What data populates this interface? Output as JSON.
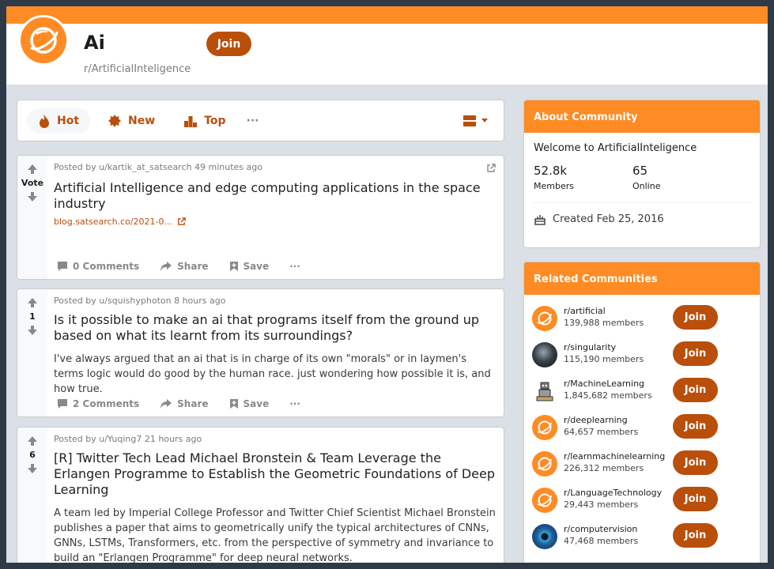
{
  "subreddit": {
    "title": "Ai",
    "name": "r/ArtificialInteligence",
    "join_label": "Join"
  },
  "sort": {
    "hot": "Hot",
    "new": "New",
    "top": "Top",
    "more": "···"
  },
  "posts": [
    {
      "meta": "Posted by u/kartik_at_satsearch 49 minutes ago",
      "vote": "Vote",
      "title": "Artificial Intelligence and edge computing applications in the space industry",
      "link": "blog.satsearch.co/2021-0...",
      "comments": "0 Comments",
      "share": "Share",
      "save": "Save"
    },
    {
      "meta": "Posted by u/squishyphoton 8 hours ago",
      "vote": "1",
      "title": "Is it possible to make an ai that programs itself from the ground up based on what its learnt from its surroundings?",
      "text": "I've always argued that an ai that is in charge of its own \"morals\" or in laymen's terms logic would do good by the human race. just wondering how possible it is, and how true.",
      "comments": "2 Comments",
      "share": "Share",
      "save": "Save"
    },
    {
      "meta": "Posted by u/Yuqing7 21 hours ago",
      "vote": "6",
      "title": "[R] Twitter Tech Lead Michael Bronstein & Team Leverage the Erlangen Programme to Establish the Geometric Foundations of Deep Learning",
      "text": "A team led by Imperial College Professor and Twitter Chief Scientist Michael Bronstein publishes a paper that aims to geometrically unify the typical architectures of CNNs, GNNs, LSTMs, Transformers, etc. from the perspective of symmetry and invariance to build an \"Erlangen Programme\" for deep neural networks."
    }
  ],
  "about": {
    "header": "About Community",
    "welcome": "Welcome to ArtificialInteligence",
    "members_count": "52.8k",
    "members_label": "Members",
    "online_count": "65",
    "online_label": "Online",
    "created": "Created Feb 25, 2016"
  },
  "related": {
    "header": "Related Communities",
    "join_label": "Join",
    "items": [
      {
        "name": "r/artificial",
        "members": "139,988 members",
        "icon": "planet-logo"
      },
      {
        "name": "r/singularity",
        "members": "115,190 members",
        "icon": "dark-orb"
      },
      {
        "name": "r/MachineLearning",
        "members": "1,845,682 members",
        "icon": "robot-illustration"
      },
      {
        "name": "r/deeplearning",
        "members": "64,657 members",
        "icon": "planet-logo"
      },
      {
        "name": "r/learnmachinelearning",
        "members": "226,312 members",
        "icon": "planet-logo"
      },
      {
        "name": "r/LanguageTechnology",
        "members": "29,443 members",
        "icon": "planet-logo"
      },
      {
        "name": "r/computervision",
        "members": "47,468 members",
        "icon": "eye-logo"
      }
    ]
  },
  "colors": {
    "accent": "#ff8b24",
    "button": "#b94f0b"
  }
}
